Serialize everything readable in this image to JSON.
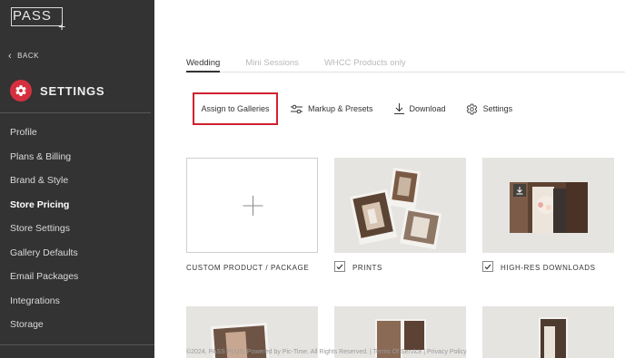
{
  "brand": {
    "logo_text": "PASS",
    "logo_plus": "+"
  },
  "sidebar": {
    "back_label": "BACK",
    "settings_title": "SETTINGS",
    "accent": "#d5303f",
    "items": [
      {
        "label": "Profile"
      },
      {
        "label": "Plans & Billing"
      },
      {
        "label": "Brand & Style"
      },
      {
        "label": "Store Pricing",
        "active": true
      },
      {
        "label": "Store Settings"
      },
      {
        "label": "Gallery Defaults"
      },
      {
        "label": "Email Packages"
      },
      {
        "label": "Integrations"
      },
      {
        "label": "Storage"
      }
    ]
  },
  "tabs": [
    {
      "label": "Wedding",
      "active": true
    },
    {
      "label": "Mini Sessions"
    },
    {
      "label": "WHCC Products only"
    }
  ],
  "toolbar": {
    "assign_label": "Assign to Galleries",
    "markup_label": "Markup & Presets",
    "download_label": "Download",
    "settings_label": "Settings",
    "highlight_color": "#d0202e"
  },
  "cards": [
    {
      "label": "CUSTOM PRODUCT / PACKAGE",
      "checked": false
    },
    {
      "label": "PRINTS",
      "checked": true
    },
    {
      "label": "HIGH-RES DOWNLOADS",
      "checked": true
    }
  ],
  "footer": {
    "text": "©2024, PASS PLUS. Powered by Pic-Time. All Rights Reserved. | Terms Of Service | Privacy Policy"
  }
}
